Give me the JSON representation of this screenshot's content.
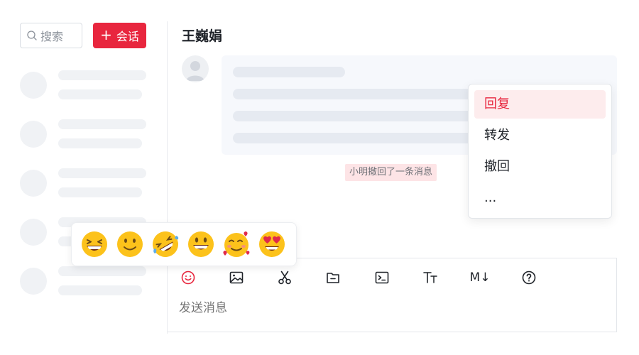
{
  "sidebar": {
    "search": {
      "placeholder": "搜索"
    },
    "new_chat_label": "会话",
    "new_chat_icon": "plus-icon",
    "accent_color": "#e8263e"
  },
  "chat": {
    "title": "王巍娟",
    "recall_notice": "小明撤回了一条消息"
  },
  "context_menu": {
    "items": [
      {
        "label": "回复",
        "active": true
      },
      {
        "label": "转发",
        "active": false
      },
      {
        "label": "撤回",
        "active": false
      },
      {
        "label": "...",
        "active": false
      }
    ]
  },
  "toolbar": {
    "tools": [
      "emoji-icon",
      "image-icon",
      "scissors-icon",
      "folder-icon",
      "terminal-icon",
      "text-format-icon",
      "markdown-icon",
      "help-icon"
    ],
    "markdown_label": "M↓"
  },
  "composer": {
    "placeholder": "发送消息"
  },
  "emoji_panel": {
    "emojis": [
      "grinning-squinting-face",
      "slightly-smiling-face",
      "rolling-on-floor-laughing",
      "grinning-face-big-eyes",
      "smiling-face-with-hearts",
      "heart-eyes-face"
    ]
  }
}
